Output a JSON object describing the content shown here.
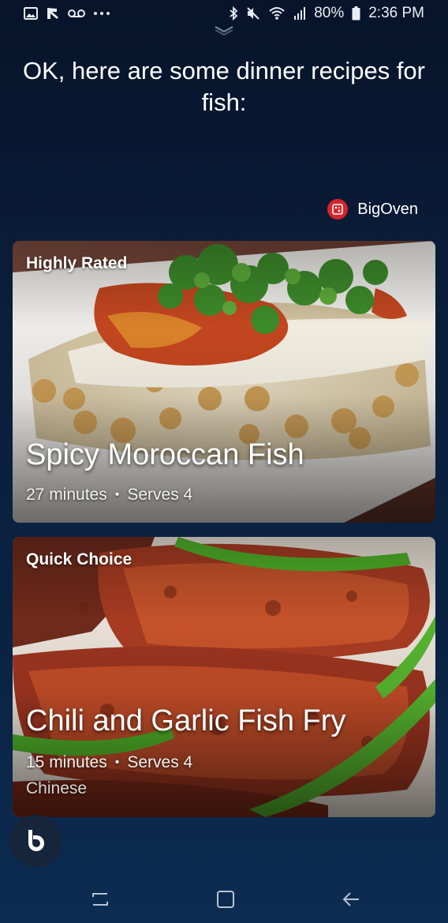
{
  "status_bar": {
    "left_icons": [
      "gallery-icon",
      "missed-call-icon",
      "voicemail-icon",
      "more-dots-icon"
    ],
    "right_icons": [
      "bluetooth-icon",
      "mute-icon",
      "wifi-icon",
      "signal-icon",
      "battery-icon"
    ],
    "battery": "80%",
    "time": "2:36 PM"
  },
  "assistant": {
    "response": "OK, here are some dinner recipes for fish:"
  },
  "source": {
    "name": "BigOven",
    "brand_color": "#d7232c"
  },
  "recipes": [
    {
      "tag": "Highly Rated",
      "title": "Spicy Moroccan Fish",
      "time": "27 minutes",
      "serves": "Serves 4",
      "separator": "•"
    },
    {
      "tag": "Quick Choice",
      "title": "Chili and Garlic Fish Fry",
      "time": "15 minutes",
      "serves": "Serves 4",
      "separator": "•",
      "cuisine": "Chinese"
    }
  ],
  "nav": {
    "buttons": [
      "recent-apps-icon",
      "home-icon",
      "back-icon"
    ]
  }
}
